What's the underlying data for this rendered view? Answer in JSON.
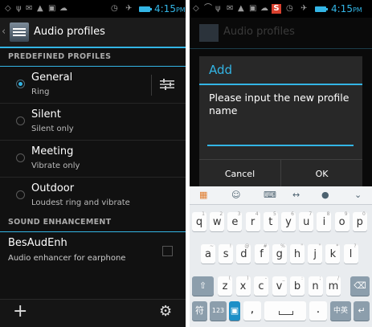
{
  "left_screen": {
    "status": {
      "time": "4:15",
      "ampm": "PM"
    },
    "action_bar": {
      "title": "Audio profiles"
    },
    "section_profiles": "PREDEFINED PROFILES",
    "profiles": [
      {
        "name": "General",
        "summary": "Ring",
        "selected": true
      },
      {
        "name": "Silent",
        "summary": "Silent only",
        "selected": false
      },
      {
        "name": "Meeting",
        "summary": "Vibrate only",
        "selected": false
      },
      {
        "name": "Outdoor",
        "summary": "Loudest ring and vibrate",
        "selected": false
      }
    ],
    "section_enhancement": "SOUND ENHANCEMENT",
    "enhancement": {
      "title": "BesAudEnh",
      "summary": "Audio enhancer for earphone",
      "checked": false
    },
    "bottom_bar": {
      "add_icon": "plus-icon",
      "reset_icon": "settings-reset-icon"
    }
  },
  "right_screen": {
    "status": {
      "time": "4:15",
      "ampm": "PM"
    },
    "background_title": "Audio profiles",
    "dialog": {
      "title": "Add",
      "message": "Please input the new profile name",
      "input_value": "",
      "cancel_label": "Cancel",
      "ok_label": "OK"
    },
    "keyboard": {
      "row1": [
        {
          "k": "q",
          "a": "1"
        },
        {
          "k": "w",
          "a": "2"
        },
        {
          "k": "e",
          "a": "3"
        },
        {
          "k": "r",
          "a": "4"
        },
        {
          "k": "t",
          "a": "5"
        },
        {
          "k": "y",
          "a": "6"
        },
        {
          "k": "u",
          "a": "7"
        },
        {
          "k": "i",
          "a": "8"
        },
        {
          "k": "o",
          "a": "9"
        },
        {
          "k": "p",
          "a": "0"
        }
      ],
      "row2": [
        {
          "k": "a",
          "a": "~"
        },
        {
          "k": "s",
          "a": "!"
        },
        {
          "k": "d",
          "a": "@"
        },
        {
          "k": "f",
          "a": "#"
        },
        {
          "k": "g",
          "a": "%"
        },
        {
          "k": "h",
          "a": "\""
        },
        {
          "k": "j",
          "a": "\""
        },
        {
          "k": "k",
          "a": "*"
        },
        {
          "k": "l",
          "a": "?"
        }
      ],
      "row3": [
        {
          "k": "z",
          "a": "("
        },
        {
          "k": "x",
          "a": ")"
        },
        {
          "k": "c",
          "a": "-"
        },
        {
          "k": "v",
          "a": "_"
        },
        {
          "k": "b",
          "a": ":"
        },
        {
          "k": "n",
          "a": ";"
        },
        {
          "k": "m",
          "a": "/"
        }
      ],
      "symbols_label": "符",
      "numbers_label": "123",
      "comma_label": ",",
      "period_label": ".",
      "lang_label": "中英"
    }
  },
  "colors": {
    "accent": "#33b5e5",
    "background": "#111111",
    "dialog": "#282828",
    "keyboard": "#e9ecef"
  }
}
